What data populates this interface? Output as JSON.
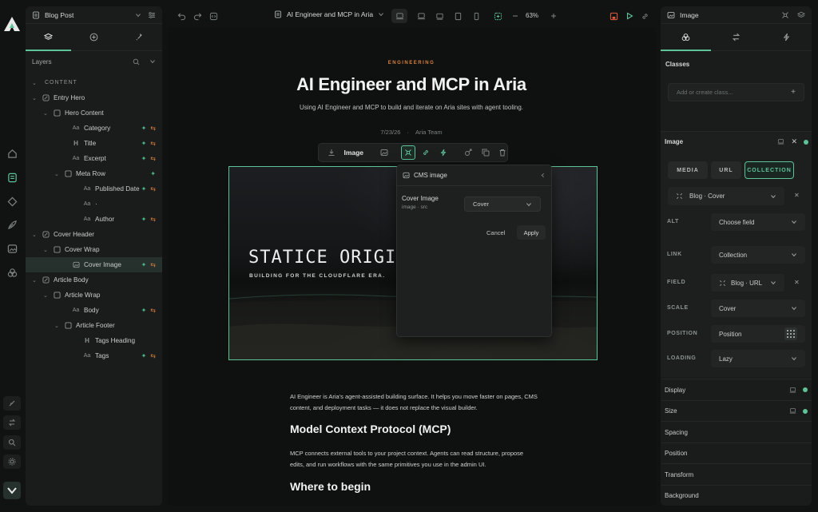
{
  "rail": {
    "icons": [
      "home-icon",
      "page-icon",
      "component-icon",
      "brush-icon",
      "image-icon",
      "layers-icon"
    ]
  },
  "left_panel": {
    "page_name": "Blog Post",
    "layers_title": "Layers",
    "tree": [
      {
        "label": "CONTENT",
        "indent": 0,
        "type": "section"
      },
      {
        "label": "Entry Hero",
        "indent": 0,
        "type": "component"
      },
      {
        "label": "Hero Content",
        "indent": 1,
        "type": "box"
      },
      {
        "label": "Category",
        "indent": 2,
        "type": "text",
        "cms": true,
        "override": true
      },
      {
        "label": "Title",
        "indent": 2,
        "type": "heading",
        "cms": true,
        "override": true
      },
      {
        "label": "Excerpt",
        "indent": 2,
        "type": "text",
        "cms": true,
        "override": true
      },
      {
        "label": "Meta Row",
        "indent": 2,
        "type": "box",
        "cms": true,
        "override": false
      },
      {
        "label": "Published Date",
        "indent": 3,
        "type": "text",
        "cms": true,
        "override": true
      },
      {
        "label": "·",
        "indent": 3,
        "type": "text",
        "cms": false,
        "override": false
      },
      {
        "label": "Author",
        "indent": 3,
        "type": "text",
        "cms": true,
        "override": true
      },
      {
        "label": "Cover Header",
        "indent": 0,
        "type": "component"
      },
      {
        "label": "Cover Wrap",
        "indent": 1,
        "type": "box"
      },
      {
        "label": "Cover Image",
        "indent": 2,
        "type": "image",
        "cms": true,
        "override": true,
        "selected": true
      },
      {
        "label": "Article Body",
        "indent": 0,
        "type": "component"
      },
      {
        "label": "Article Wrap",
        "indent": 1,
        "type": "box"
      },
      {
        "label": "Body",
        "indent": 2,
        "type": "text",
        "cms": true,
        "override": true
      },
      {
        "label": "Article Footer",
        "indent": 2,
        "type": "box"
      },
      {
        "label": "Tags Heading",
        "indent": 3,
        "type": "heading"
      },
      {
        "label": "Tags",
        "indent": 3,
        "type": "text",
        "cms": true,
        "override": true
      }
    ]
  },
  "topbar": {
    "page_title": "AI Engineer and MCP in Aria",
    "zoom": "63%"
  },
  "canvas": {
    "category": "ENGINEERING",
    "title": "AI Engineer and MCP in Aria",
    "excerpt": "Using AI Engineer and MCP to build and iterate on Aria sites with agent tooling.",
    "date": "7/23/26",
    "separator": "·",
    "author": "Aria Team",
    "toolbar_label": "Image",
    "cover_title": "STATICE ORIGINS",
    "cover_subtitle": "BUILDING FOR THE CLOUDFLARE ERA.",
    "popover": {
      "title": "CMS image",
      "field_label": "Cover Image",
      "field_sub": "image · src",
      "field_value": "Cover",
      "cancel": "Cancel",
      "apply": "Apply"
    },
    "body_p1": "AI Engineer is Aria's agent-assisted building surface. It helps you move faster on pages, CMS content, and deployment tasks — it does not replace the visual builder.",
    "h2_1": "Model Context Protocol (MCP)",
    "body_p2": "MCP connects external tools to your project context. Agents can read structure, propose edits, and run workflows with the same primitives you use in the admin UI.",
    "h2_2": "Where to begin"
  },
  "right_panel": {
    "element_name": "Image",
    "classes_title": "Classes",
    "class_placeholder": "Add or create class...",
    "image_title": "Image",
    "source_tabs": [
      "MEDIA",
      "URL",
      "COLLECTION"
    ],
    "active_source": "COLLECTION",
    "binding": "Blog · Cover",
    "alt_label": "ALT",
    "alt_value": "Choose field",
    "link_label": "LINK",
    "link_value": "Collection",
    "field_label": "FIELD",
    "field_value": "Blog · URL",
    "scale_label": "SCALE",
    "scale_value": "Cover",
    "position_label": "POSITION",
    "position_value": "Position",
    "loading_label": "LOADING",
    "loading_value": "Lazy",
    "sections": [
      "Display",
      "Size",
      "Spacing",
      "Position",
      "Transform",
      "Background"
    ]
  },
  "colors": {
    "accent": "#5fc39a",
    "cms": "#4fb58a",
    "override": "#d9803f",
    "danger": "#e05b3c"
  }
}
